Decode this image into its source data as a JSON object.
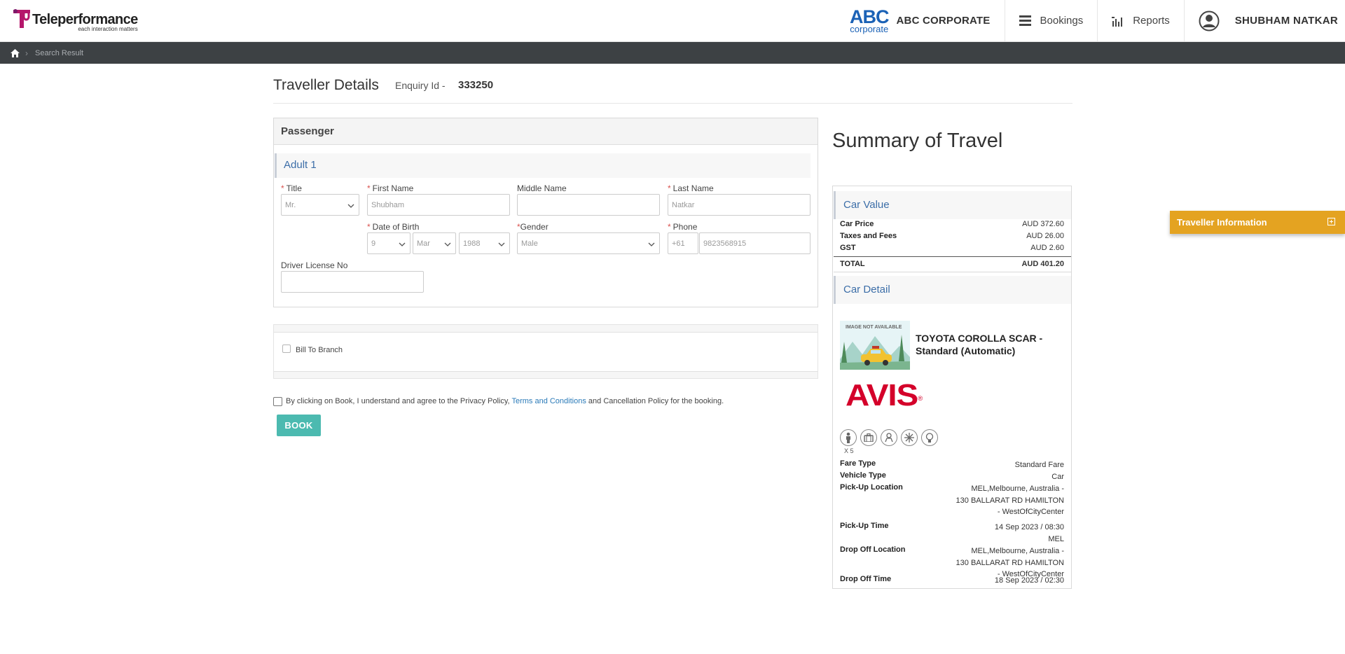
{
  "header": {
    "brand_name": "Teleperformance",
    "brand_tagline": "each interaction matters",
    "corp_logo_big": "ABC",
    "corp_logo_small": "corporate",
    "corporate_name": "ABC CORPORATE",
    "nav_bookings": "Bookings",
    "nav_reports": "Reports",
    "user_name": "SHUBHAM NATKAR"
  },
  "breadcrumb": {
    "current": "Search Result"
  },
  "page": {
    "title": "Traveller Details",
    "enquiry_label": "Enquiry Id -",
    "enquiry_id": "333250"
  },
  "passenger": {
    "section_title": "Passenger",
    "adult_title": "Adult 1",
    "title_label": "Title",
    "title_value": "Mr.",
    "first_name_label": "First Name",
    "first_name_value": "Shubham",
    "middle_name_label": "Middle Name",
    "middle_name_value": "",
    "last_name_label": "Last Name",
    "last_name_value": "Natkar",
    "dob_label": "Date of Birth",
    "dob_day": "9",
    "dob_month": "Mar",
    "dob_year": "1988",
    "gender_label": "Gender",
    "gender_value": "Male",
    "phone_label": "Phone",
    "phone_code": "+61",
    "phone_number": "9823568915",
    "license_label": "Driver License No",
    "license_value": ""
  },
  "billing": {
    "bill_to_branch_label": "Bill To Branch"
  },
  "agreement": {
    "text_before": "By clicking on Book, I understand and agree to the Privacy Policy,",
    "link": "Terms and Conditions",
    "text_after": "and Cancellation Policy for the booking."
  },
  "book_button": "BOOK",
  "summary": {
    "title": "Summary of Travel",
    "car_value_title": "Car Value",
    "car_price_label": "Car Price",
    "car_price_value": "AUD 372.60",
    "taxes_label": "Taxes and Fees",
    "taxes_value": "AUD 26.00",
    "gst_label": "GST",
    "gst_value": "AUD 2.60",
    "total_label": "TOTAL",
    "total_value": "AUD 401.20",
    "car_detail_title": "Car Detail",
    "image_placeholder": "IMAGE NOT AVAILABLE",
    "car_name": "TOYOTA COROLLA SCAR - Standard (Automatic)",
    "vendor": "AVIS",
    "vendor_mark": "®",
    "passengers": "X 5",
    "fare_type_label": "Fare Type",
    "fare_type_value": "Standard Fare",
    "vehicle_type_label": "Vehicle Type",
    "vehicle_type_value": "Car",
    "pickup_location_label": "Pick-Up Location",
    "pickup_location_line1": "MEL,Melbourne, Australia -",
    "pickup_location_line2": "130 BALLARAT RD HAMILTON",
    "pickup_location_line3": "- WestOfCityCenter",
    "pickup_time_label": "Pick-Up Time",
    "pickup_time_line1": "14 Sep 2023 / 08:30",
    "pickup_time_line2": "MEL",
    "dropoff_location_label": "Drop Off Location",
    "dropoff_location_line1": "MEL,Melbourne, Australia -",
    "dropoff_location_line2": "130 BALLARAT RD HAMILTON",
    "dropoff_location_line3": "- WestOfCityCenter",
    "dropoff_time_label": "Drop Off Time",
    "dropoff_time_value": "18 Sep 2023 / 02:30"
  },
  "traveller_tab": {
    "label": "Traveller Information"
  },
  "colors": {
    "accent_teal": "#4cbab0",
    "tab_orange": "#e4a321",
    "section_blue": "#3c6ea8",
    "avis_red": "#d4002a",
    "brand_magenta": "#b5166b",
    "breadcrumb_bg": "#3d4144"
  },
  "icons": [
    "home-icon",
    "menu-icon",
    "reports-icon",
    "user-icon",
    "chevron-down-icon",
    "person-icon",
    "luggage-icon",
    "seat-icon",
    "ac-icon",
    "bulb-icon",
    "plus-square-icon"
  ]
}
